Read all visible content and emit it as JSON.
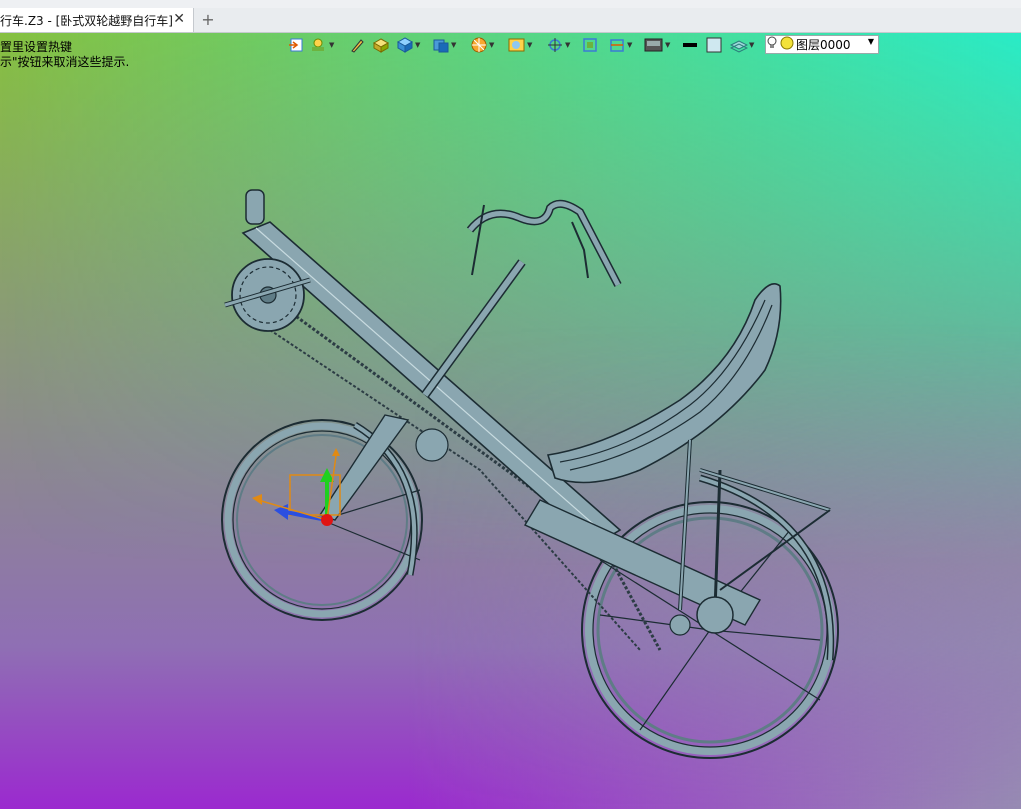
{
  "document_tab": {
    "title": "行车.Z3 - [卧式双轮越野自行车]",
    "close_glyph": "✕"
  },
  "new_tab": {
    "glyph": "+"
  },
  "hints": [
    "置里设置热键",
    "示\"按钮来取消这些提示."
  ],
  "toolbar": {
    "items": [
      "export-icon",
      "light-icon",
      "pen-icon",
      "box-3d-icon",
      "cube-icon",
      "view-cube-icon",
      "render-ball-icon",
      "shade-icon",
      "pivot-icon",
      "fit-icon",
      "section-icon",
      "display-mode-icon",
      "line-color-icon",
      "face-color-icon",
      "layer-manager-icon"
    ]
  },
  "layer": {
    "label": "图层0000"
  },
  "colors": {
    "bg_top_left": "#8dc63f",
    "bg_top_right": "#22f2d8",
    "bg_bottom_left": "#9b2ad0",
    "bg_bottom_right": "#8f92b0",
    "model_fill": "#8aa6b0",
    "model_stroke": "#1c2c33",
    "axis_x": "#ff8a00",
    "axis_y": "#1fd01f",
    "axis_z": "#2b4fe0",
    "origin": "#e01414"
  }
}
